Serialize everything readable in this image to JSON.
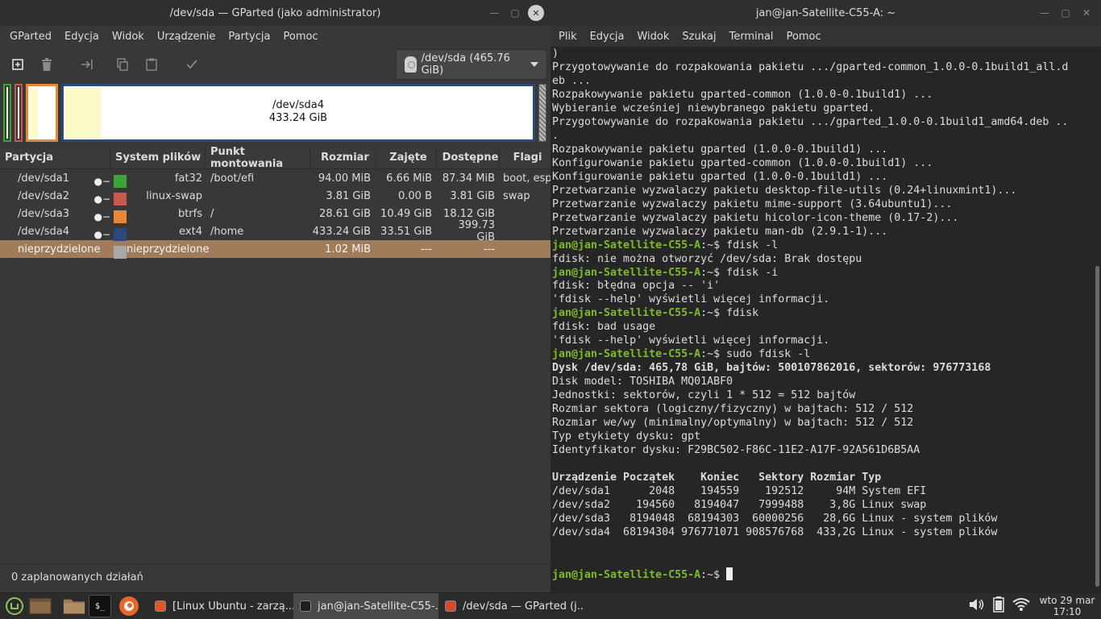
{
  "gparted": {
    "title": "/dev/sda — GParted (jako administrator)",
    "menu": [
      "GParted",
      "Edycja",
      "Widok",
      "Urządzenie",
      "Partycja",
      "Pomoc"
    ],
    "device": "/dev/sda (465.76 GiB)",
    "diskmap": {
      "selected_name": "/dev/sda4",
      "selected_size": "433.24 GiB"
    },
    "columns": [
      "Partycja",
      "System plików",
      "Punkt montowania",
      "Rozmiar",
      "Zajęte",
      "Dostępne",
      "Flagi"
    ],
    "rows": [
      {
        "part": "/dev/sda1",
        "fs": "fat32",
        "color": "#3aa33a",
        "mount": "/boot/efi",
        "size": "94.00 MiB",
        "used": "6.66 MiB",
        "free": "87.34 MiB",
        "flags": "boot, esp"
      },
      {
        "part": "/dev/sda2",
        "fs": "linux-swap",
        "color": "#c85a4a",
        "mount": "",
        "size": "3.81 GiB",
        "used": "0.00 B",
        "free": "3.81 GiB",
        "flags": "swap"
      },
      {
        "part": "/dev/sda3",
        "fs": "btrfs",
        "color": "#e8863a",
        "mount": "/",
        "size": "28.61 GiB",
        "used": "10.49 GiB",
        "free": "18.12 GiB",
        "flags": ""
      },
      {
        "part": "/dev/sda4",
        "fs": "ext4",
        "color": "#2a4a7a",
        "mount": "/home",
        "size": "433.24 GiB",
        "used": "33.51 GiB",
        "free": "399.73 GiB",
        "flags": ""
      },
      {
        "part": "nieprzydzielone",
        "fs": "nieprzydzielone",
        "color": "#a8a8a8",
        "mount": "",
        "size": "1.02 MiB",
        "used": "---",
        "free": "---",
        "flags": ""
      }
    ],
    "status": "0 zaplanowanych działań"
  },
  "terminal": {
    "title": "jan@jan-Satellite-C55-A: ~",
    "menu": [
      "Plik",
      "Edycja",
      "Widok",
      "Szukaj",
      "Terminal",
      "Pomoc"
    ],
    "prompt_user": "jan@jan-Satellite-C55-A",
    "prompt_suffix": ":~$ ",
    "lines": [
      {
        "t": "out",
        "text": ")"
      },
      {
        "t": "out",
        "text": "Przygotowywanie do rozpakowania pakietu .../gparted-common_1.0.0-0.1build1_all.d"
      },
      {
        "t": "out",
        "text": "eb ..."
      },
      {
        "t": "out",
        "text": "Rozpakowywanie pakietu gparted-common (1.0.0-0.1build1) ..."
      },
      {
        "t": "out",
        "text": "Wybieranie wcześniej niewybranego pakietu gparted."
      },
      {
        "t": "out",
        "text": "Przygotowywanie do rozpakowania pakietu .../gparted_1.0.0-0.1build1_amd64.deb .."
      },
      {
        "t": "out",
        "text": "."
      },
      {
        "t": "out",
        "text": "Rozpakowywanie pakietu gparted (1.0.0-0.1build1) ..."
      },
      {
        "t": "out",
        "text": "Konfigurowanie pakietu gparted-common (1.0.0-0.1build1) ..."
      },
      {
        "t": "out",
        "text": "Konfigurowanie pakietu gparted (1.0.0-0.1build1) ..."
      },
      {
        "t": "out",
        "text": "Przetwarzanie wyzwalaczy pakietu desktop-file-utils (0.24+linuxmint1)..."
      },
      {
        "t": "out",
        "text": "Przetwarzanie wyzwalaczy pakietu mime-support (3.64ubuntu1)..."
      },
      {
        "t": "out",
        "text": "Przetwarzanie wyzwalaczy pakietu hicolor-icon-theme (0.17-2)..."
      },
      {
        "t": "out",
        "text": "Przetwarzanie wyzwalaczy pakietu man-db (2.9.1-1)..."
      },
      {
        "t": "cmd",
        "text": "fdisk -l"
      },
      {
        "t": "out",
        "text": "fdisk: nie można otworzyć /dev/sda: Brak dostępu"
      },
      {
        "t": "cmd",
        "text": "fdisk -i"
      },
      {
        "t": "out",
        "text": "fdisk: błędna opcja -- 'i'"
      },
      {
        "t": "out",
        "text": "'fdisk --help' wyświetli więcej informacji."
      },
      {
        "t": "cmd",
        "text": "fdisk"
      },
      {
        "t": "out",
        "text": "fdisk: bad usage"
      },
      {
        "t": "out",
        "text": "'fdisk --help' wyświetli więcej informacji."
      },
      {
        "t": "cmd",
        "text": "sudo fdisk -l"
      },
      {
        "t": "bold",
        "text": "Dysk /dev/sda: 465,78 GiB, bajtów: 500107862016, sektorów: 976773168"
      },
      {
        "t": "out",
        "text": "Disk model: TOSHIBA MQ01ABF0"
      },
      {
        "t": "out",
        "text": "Jednostki: sektorów, czyli 1 * 512 = 512 bajtów"
      },
      {
        "t": "out",
        "text": "Rozmiar sektora (logiczny/fizyczny) w bajtach: 512 / 512"
      },
      {
        "t": "out",
        "text": "Rozmiar we/wy (minimalny/optymalny) w bajtach: 512 / 512"
      },
      {
        "t": "out",
        "text": "Typ etykiety dysku: gpt"
      },
      {
        "t": "out",
        "text": "Identyfikator dysku: F29BC502-F86C-11E2-A17F-92A561D6B5AA"
      },
      {
        "t": "out",
        "text": ""
      },
      {
        "t": "bold",
        "text": "Urządzenie Początek    Koniec   Sektory Rozmiar Typ"
      },
      {
        "t": "out",
        "text": "/dev/sda1      2048    194559    192512     94M System EFI"
      },
      {
        "t": "out",
        "text": "/dev/sda2    194560   8194047   7999488    3,8G Linux swap"
      },
      {
        "t": "out",
        "text": "/dev/sda3   8194048  68194303  60000256   28,6G Linux - system plików"
      },
      {
        "t": "out",
        "text": "/dev/sda4  68194304 976771071 908576768  433,2G Linux - system plików"
      },
      {
        "t": "out",
        "text": ""
      },
      {
        "t": "out",
        "text": ""
      },
      {
        "t": "prompt",
        "text": ""
      }
    ]
  },
  "taskbar": {
    "tasks": [
      {
        "label": "[Linux Ubuntu - zarzą...",
        "icon_color": "#e0572a"
      },
      {
        "label": "jan@jan-Satellite-C55-...",
        "icon_color": "#1e1e1e"
      },
      {
        "label": "/dev/sda — GParted (j...",
        "icon_color": "#d84a2e"
      }
    ],
    "clock_date": "wto 29 mar",
    "clock_time": "17:10"
  }
}
